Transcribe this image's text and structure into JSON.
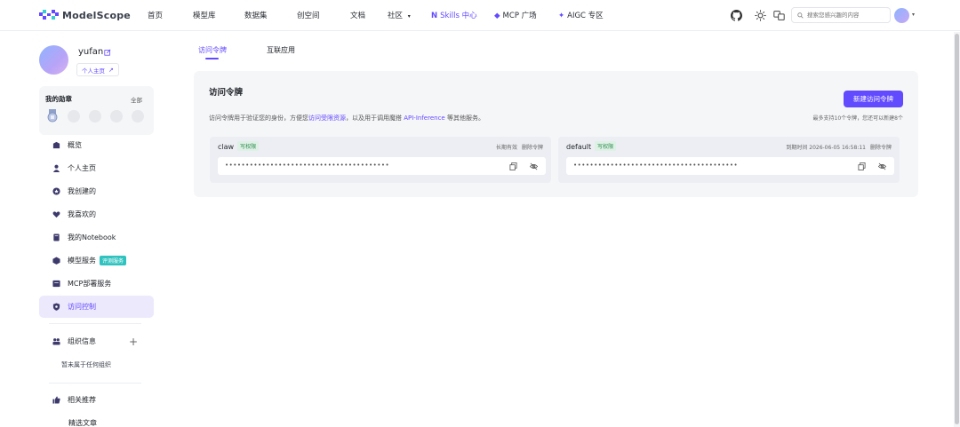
{
  "brand": {
    "name": "ModelScope",
    "accent": "#624aff"
  },
  "nav": {
    "items": [
      "首页",
      "模型库",
      "数据集",
      "创空间",
      "文档"
    ],
    "community": "社区",
    "skills": "Skills 中心",
    "mcp": "MCP 广场",
    "aigc": "AIGC 专区"
  },
  "search": {
    "placeholder": "搜索您感兴趣的内容"
  },
  "profile": {
    "name": "yufan",
    "home_link": "个人主页"
  },
  "badges": {
    "title": "我的勋章",
    "all": "全部"
  },
  "menu": [
    {
      "label": "概览",
      "icon": "overview-icon"
    },
    {
      "label": "个人主页",
      "icon": "user-icon"
    },
    {
      "label": "我创建的",
      "icon": "created-icon"
    },
    {
      "label": "我喜欢的",
      "icon": "heart-icon"
    },
    {
      "label": "我的Notebook",
      "icon": "notebook-icon"
    },
    {
      "label": "模型服务",
      "icon": "model-service-icon",
      "tag": "评测服务"
    },
    {
      "label": "MCP部署服务",
      "icon": "mcp-deploy-icon"
    },
    {
      "label": "访问控制",
      "icon": "shield-icon",
      "active": true
    }
  ],
  "org": {
    "title": "组织信息",
    "empty": "暂未属于任何组织"
  },
  "recommend": {
    "title": "相关推荐",
    "article": "精选文章"
  },
  "tabs": [
    {
      "label": "访问令牌",
      "active": true
    },
    {
      "label": "互联应用",
      "active": false
    }
  ],
  "panel": {
    "title": "访问令牌",
    "new_button": "新建访问令牌",
    "desc_prefix": "访问令牌用于验证您的身份，方便您",
    "desc_link1": "访问受限资源",
    "desc_mid": "，以及用于调用魔搭 ",
    "desc_link2": "API-Inference",
    "desc_suffix": " 等其他服务。",
    "quota": "最多支持10个令牌，您还可以新建8个"
  },
  "tokens": [
    {
      "name": "claw",
      "permission": "写权限",
      "expiry": "长期有效",
      "delete": "删除令牌",
      "masked": "••••••••••••••••••••••••••••••••••••••••"
    },
    {
      "name": "default",
      "permission": "写权限",
      "expiry": "到期时间 2026-06-05 16:58:11",
      "delete": "删除令牌",
      "masked": "••••••••••••••••••••••••••••••••••••••••"
    }
  ]
}
